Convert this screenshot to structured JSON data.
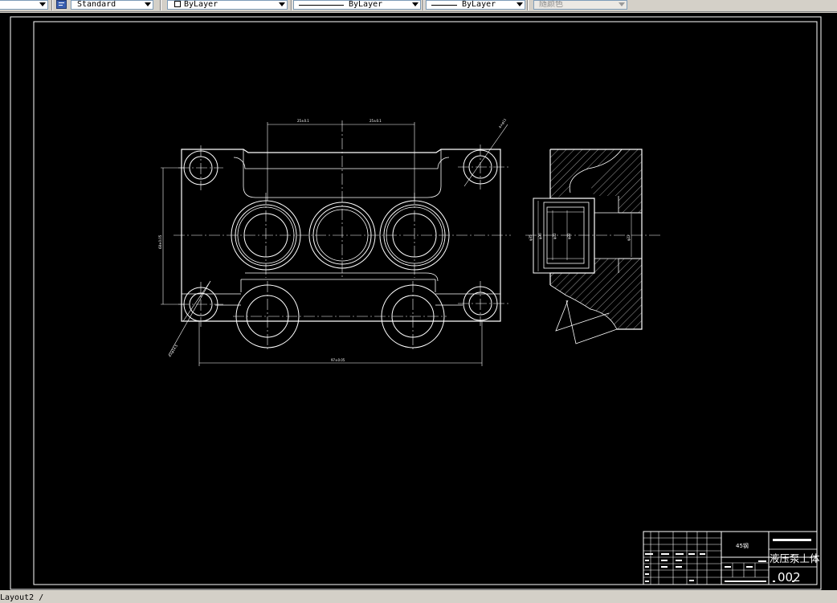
{
  "toolbar": {
    "textstyle": "Standard",
    "layer": "ByLayer",
    "linetype": "ByLayer",
    "lineweight": "ByLayer",
    "color": "随颜色"
  },
  "drawing": {
    "dims": {
      "top_left": "25±0.1",
      "top_right": "25±0.1",
      "diag_top": "4×φ11",
      "left_vert": "68±0.05",
      "diag_bottom": "4×φ14.5",
      "bottom": "97±0.05",
      "sec1": "φ35",
      "sec2": "φ30",
      "sec3": "φ32",
      "sec4": "φ22",
      "sec5": "φ22"
    },
    "title_block": {
      "material": "45钢",
      "part_name": "液压泵上体",
      "number": "002"
    }
  },
  "status": {
    "tab": "Layout2"
  }
}
